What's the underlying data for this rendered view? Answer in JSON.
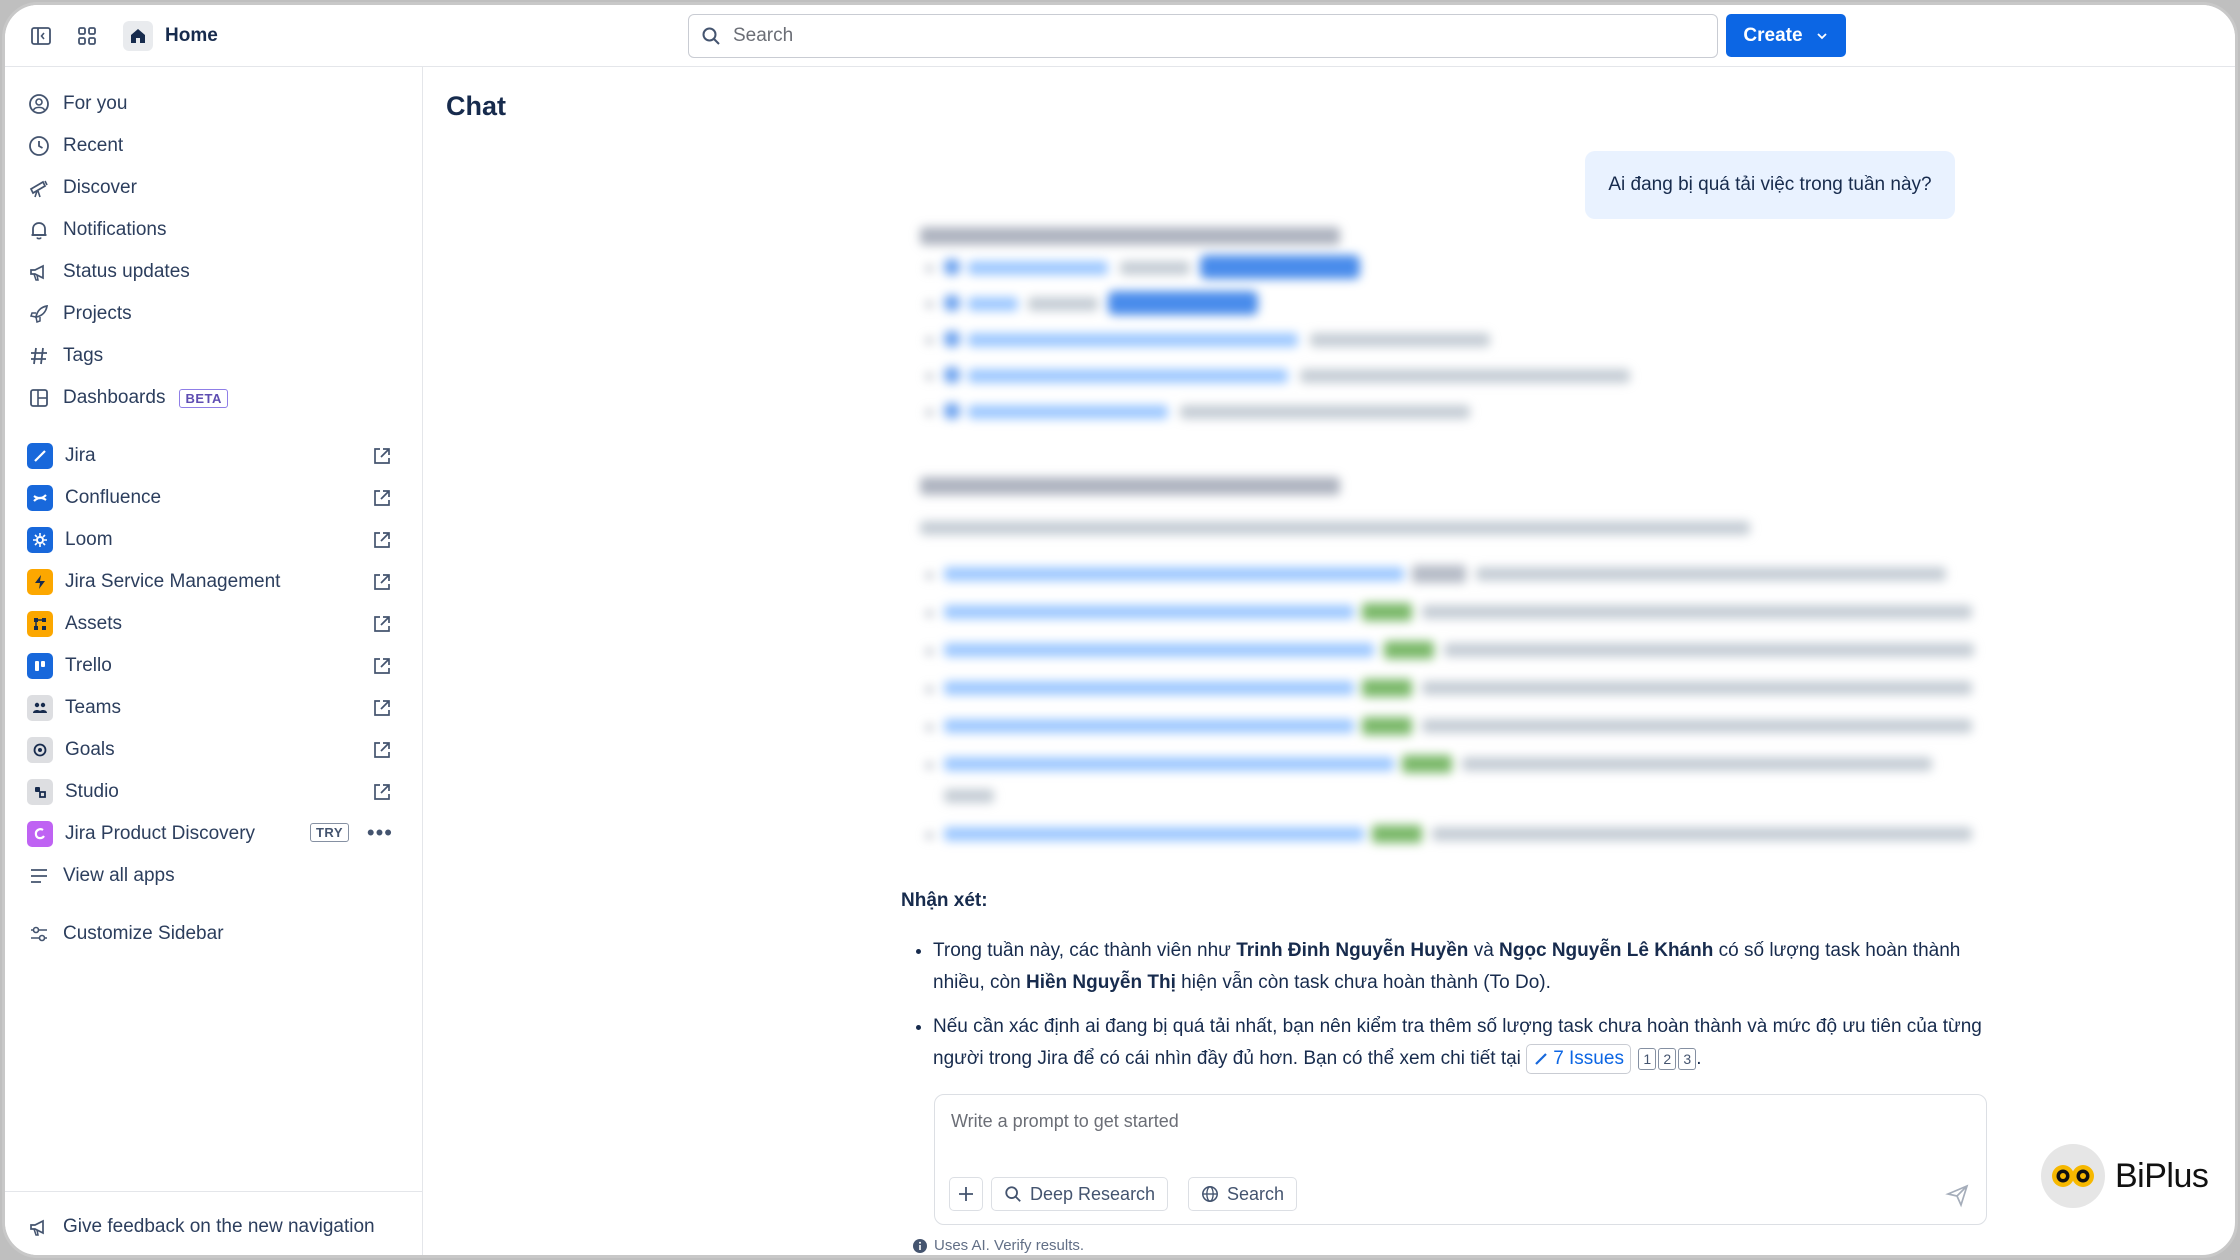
{
  "topbar": {
    "home_label": "Home",
    "search_placeholder": "Search",
    "create_label": "Create"
  },
  "sidebar": {
    "nav_items": [
      {
        "label": "For you",
        "icon": "person-circle-icon"
      },
      {
        "label": "Recent",
        "icon": "clock-icon"
      },
      {
        "label": "Discover",
        "icon": "telescope-icon"
      },
      {
        "label": "Notifications",
        "icon": "bell-icon"
      },
      {
        "label": "Status updates",
        "icon": "megaphone-icon"
      },
      {
        "label": "Projects",
        "icon": "rocket-icon"
      },
      {
        "label": "Tags",
        "icon": "hash-icon"
      },
      {
        "label": "Dashboards",
        "icon": "dashboard-icon",
        "badge": "BETA"
      }
    ],
    "apps": [
      {
        "label": "Jira",
        "color": "#1868db"
      },
      {
        "label": "Confluence",
        "color": "#1868db"
      },
      {
        "label": "Loom",
        "color": "#1868db"
      },
      {
        "label": "Jira Service Management",
        "color": "#fca700"
      },
      {
        "label": "Assets",
        "color": "#fca700"
      },
      {
        "label": "Trello",
        "color": "#1868db"
      },
      {
        "label": "Teams",
        "color": "#dddee1"
      },
      {
        "label": "Goals",
        "color": "#dddee1"
      },
      {
        "label": "Studio",
        "color": "#dddee1"
      },
      {
        "label": "Jira Product Discovery",
        "color": "#bf63f3",
        "badge": "TRY"
      }
    ],
    "view_all_apps": "View all apps",
    "customize": "Customize Sidebar",
    "feedback": "Give feedback on the new navigation"
  },
  "main": {
    "title": "Chat",
    "user_message": "Ai đang bị quá tải việc trong tuần này?",
    "analysis": {
      "heading": "Nhận xét:",
      "bullet1": {
        "pre": "Trong tuần này, các thành viên như ",
        "name1": "Trinh Đinh Nguyễn Huyền",
        "mid1": " và ",
        "name2": "Ngọc Nguyễn Lê Khánh",
        "mid2": " có số lượng task hoàn thành nhiều, còn ",
        "name3": "Hiền Nguyễn Thị",
        "post": " hiện vẫn còn task chưa hoàn thành (To Do)."
      },
      "bullet2": {
        "text": "Nếu cần xác định ai đang bị quá tải nhất, bạn nên kiểm tra thêm số lượng task chưa hoàn thành và mức độ ưu tiên của từng người trong Jira để có cái nhìn đầy đủ hơn. Bạn có thể xem chi tiết tại ",
        "chip": "7 Issues",
        "refs": [
          "1",
          "2",
          "3"
        ],
        "end": "."
      }
    },
    "prompt": {
      "placeholder": "Write a prompt to get started",
      "deep_research": "Deep Research",
      "search": "Search"
    },
    "disclaimer": "Uses AI. Verify results."
  },
  "watermark": "BiPlus"
}
